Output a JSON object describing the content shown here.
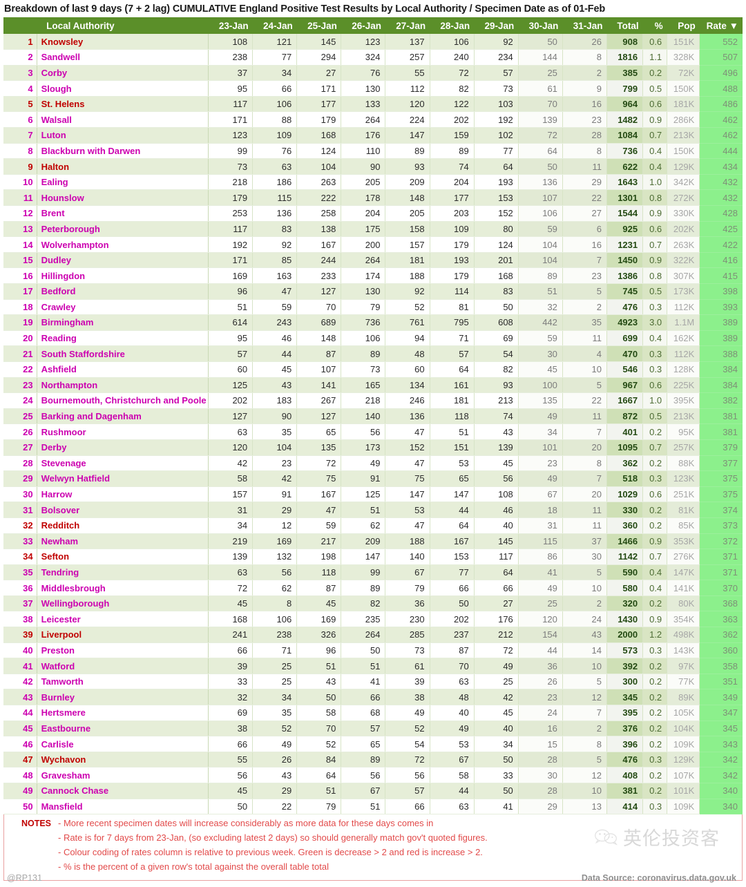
{
  "title": "Breakdown of last 9 days (7 + 2 lag)  CUMULATIVE England Positive Test Results by Local Authority / Specimen Date as of 01-Feb",
  "columns": {
    "rank": "",
    "name": "Local Authority",
    "days": [
      "23-Jan",
      "24-Jan",
      "25-Jan",
      "26-Jan",
      "27-Jan",
      "28-Jan",
      "29-Jan",
      "30-Jan",
      "31-Jan"
    ],
    "total": "Total",
    "pct": "%",
    "pop": "Pop",
    "rate": "Rate ▼"
  },
  "notes": {
    "label": "NOTES",
    "lines": [
      "- More recent specimen dates will increase considerably as more data for these days comes in",
      "- Rate is for 7 days from 23-Jan, (so excluding latest 2 days) so should generally match gov't quoted figures.",
      "- Colour coding of rates column is relative to previous week. Green is decrease > 2 and red is increase > 2.",
      "- % is the percent of a given row's total against the overall table total"
    ]
  },
  "watermark": "英伦投资客",
  "footer": {
    "handle": "@RP131",
    "source": "Data Source: coronavirus.data.gov.uk"
  },
  "colors": {
    "header_green": "#5b8f29",
    "rate_green": "#8cf08c",
    "name_magenta": "#cc00b0",
    "name_red": "#c00000",
    "notes_red": "#e24a4a"
  },
  "chart_data": {
    "type": "table",
    "title": "Breakdown of last 9 days (7 + 2 lag)  CUMULATIVE England Positive Test Results by Local Authority / Specimen Date as of 01-Feb",
    "columns": [
      "Rank",
      "Local Authority",
      "23-Jan",
      "24-Jan",
      "25-Jan",
      "26-Jan",
      "27-Jan",
      "28-Jan",
      "29-Jan",
      "30-Jan",
      "31-Jan",
      "Total",
      "%",
      "Pop",
      "Rate"
    ],
    "lag_columns": [
      "30-Jan",
      "31-Jan"
    ],
    "sorted_by": "Rate",
    "sort_direction": "descending",
    "rows": [
      {
        "rank": 1,
        "name": "Knowsley",
        "flag": "red",
        "v": [
          108,
          121,
          145,
          123,
          137,
          106,
          92,
          50,
          26
        ],
        "total": "908",
        "pct": "0.6",
        "pop": "151K",
        "rate": "552"
      },
      {
        "rank": 2,
        "name": "Sandwell",
        "flag": "mag",
        "v": [
          238,
          77,
          294,
          324,
          257,
          240,
          234,
          144,
          8
        ],
        "total": "1816",
        "pct": "1.1",
        "pop": "328K",
        "rate": "507"
      },
      {
        "rank": 3,
        "name": "Corby",
        "flag": "mag",
        "v": [
          37,
          34,
          27,
          76,
          55,
          72,
          57,
          25,
          2
        ],
        "total": "385",
        "pct": "0.2",
        "pop": "72K",
        "rate": "496"
      },
      {
        "rank": 4,
        "name": "Slough",
        "flag": "mag",
        "v": [
          95,
          66,
          171,
          130,
          112,
          82,
          73,
          61,
          9
        ],
        "total": "799",
        "pct": "0.5",
        "pop": "150K",
        "rate": "488"
      },
      {
        "rank": 5,
        "name": "St. Helens",
        "flag": "red",
        "v": [
          117,
          106,
          177,
          133,
          120,
          122,
          103,
          70,
          16
        ],
        "total": "964",
        "pct": "0.6",
        "pop": "181K",
        "rate": "486"
      },
      {
        "rank": 6,
        "name": "Walsall",
        "flag": "mag",
        "v": [
          171,
          88,
          179,
          264,
          224,
          202,
          192,
          139,
          23
        ],
        "total": "1482",
        "pct": "0.9",
        "pop": "286K",
        "rate": "462"
      },
      {
        "rank": 7,
        "name": "Luton",
        "flag": "mag",
        "v": [
          123,
          109,
          168,
          176,
          147,
          159,
          102,
          72,
          28
        ],
        "total": "1084",
        "pct": "0.7",
        "pop": "213K",
        "rate": "462"
      },
      {
        "rank": 8,
        "name": "Blackburn with Darwen",
        "flag": "mag",
        "v": [
          99,
          76,
          124,
          110,
          89,
          89,
          77,
          64,
          8
        ],
        "total": "736",
        "pct": "0.4",
        "pop": "150K",
        "rate": "444"
      },
      {
        "rank": 9,
        "name": "Halton",
        "flag": "red",
        "v": [
          73,
          63,
          104,
          90,
          93,
          74,
          64,
          50,
          11
        ],
        "total": "622",
        "pct": "0.4",
        "pop": "129K",
        "rate": "434"
      },
      {
        "rank": 10,
        "name": "Ealing",
        "flag": "mag",
        "v": [
          218,
          186,
          263,
          205,
          209,
          204,
          193,
          136,
          29
        ],
        "total": "1643",
        "pct": "1.0",
        "pop": "342K",
        "rate": "432"
      },
      {
        "rank": 11,
        "name": "Hounslow",
        "flag": "mag",
        "v": [
          179,
          115,
          222,
          178,
          148,
          177,
          153,
          107,
          22
        ],
        "total": "1301",
        "pct": "0.8",
        "pop": "272K",
        "rate": "432"
      },
      {
        "rank": 12,
        "name": "Brent",
        "flag": "mag",
        "v": [
          253,
          136,
          258,
          204,
          205,
          203,
          152,
          106,
          27
        ],
        "total": "1544",
        "pct": "0.9",
        "pop": "330K",
        "rate": "428"
      },
      {
        "rank": 13,
        "name": "Peterborough",
        "flag": "mag",
        "v": [
          117,
          83,
          138,
          175,
          158,
          109,
          80,
          59,
          6
        ],
        "total": "925",
        "pct": "0.6",
        "pop": "202K",
        "rate": "425"
      },
      {
        "rank": 14,
        "name": "Wolverhampton",
        "flag": "mag",
        "v": [
          192,
          92,
          167,
          200,
          157,
          179,
          124,
          104,
          16
        ],
        "total": "1231",
        "pct": "0.7",
        "pop": "263K",
        "rate": "422"
      },
      {
        "rank": 15,
        "name": "Dudley",
        "flag": "mag",
        "v": [
          171,
          85,
          244,
          264,
          181,
          193,
          201,
          104,
          7
        ],
        "total": "1450",
        "pct": "0.9",
        "pop": "322K",
        "rate": "416"
      },
      {
        "rank": 16,
        "name": "Hillingdon",
        "flag": "mag",
        "v": [
          169,
          163,
          233,
          174,
          188,
          179,
          168,
          89,
          23
        ],
        "total": "1386",
        "pct": "0.8",
        "pop": "307K",
        "rate": "415"
      },
      {
        "rank": 17,
        "name": "Bedford",
        "flag": "mag",
        "v": [
          96,
          47,
          127,
          130,
          92,
          114,
          83,
          51,
          5
        ],
        "total": "745",
        "pct": "0.5",
        "pop": "173K",
        "rate": "398"
      },
      {
        "rank": 18,
        "name": "Crawley",
        "flag": "mag",
        "v": [
          51,
          59,
          70,
          79,
          52,
          81,
          50,
          32,
          2
        ],
        "total": "476",
        "pct": "0.3",
        "pop": "112K",
        "rate": "393"
      },
      {
        "rank": 19,
        "name": "Birmingham",
        "flag": "mag",
        "v": [
          614,
          243,
          689,
          736,
          761,
          795,
          608,
          442,
          35
        ],
        "total": "4923",
        "pct": "3.0",
        "pop": "1.1M",
        "rate": "389"
      },
      {
        "rank": 20,
        "name": "Reading",
        "flag": "mag",
        "v": [
          95,
          46,
          148,
          106,
          94,
          71,
          69,
          59,
          11
        ],
        "total": "699",
        "pct": "0.4",
        "pop": "162K",
        "rate": "389"
      },
      {
        "rank": 21,
        "name": "South Staffordshire",
        "flag": "mag",
        "v": [
          57,
          44,
          87,
          89,
          48,
          57,
          54,
          30,
          4
        ],
        "total": "470",
        "pct": "0.3",
        "pop": "112K",
        "rate": "388"
      },
      {
        "rank": 22,
        "name": "Ashfield",
        "flag": "mag",
        "v": [
          60,
          45,
          107,
          73,
          60,
          64,
          82,
          45,
          10
        ],
        "total": "546",
        "pct": "0.3",
        "pop": "128K",
        "rate": "384"
      },
      {
        "rank": 23,
        "name": "Northampton",
        "flag": "mag",
        "v": [
          125,
          43,
          141,
          165,
          134,
          161,
          93,
          100,
          5
        ],
        "total": "967",
        "pct": "0.6",
        "pop": "225K",
        "rate": "384"
      },
      {
        "rank": 24,
        "name": "Bournemouth, Christchurch and Poole",
        "flag": "mag",
        "v": [
          202,
          183,
          267,
          218,
          246,
          181,
          213,
          135,
          22
        ],
        "total": "1667",
        "pct": "1.0",
        "pop": "395K",
        "rate": "382"
      },
      {
        "rank": 25,
        "name": "Barking and Dagenham",
        "flag": "mag",
        "v": [
          127,
          90,
          127,
          140,
          136,
          118,
          74,
          49,
          11
        ],
        "total": "872",
        "pct": "0.5",
        "pop": "213K",
        "rate": "381"
      },
      {
        "rank": 26,
        "name": "Rushmoor",
        "flag": "mag",
        "v": [
          63,
          35,
          65,
          56,
          47,
          51,
          43,
          34,
          7
        ],
        "total": "401",
        "pct": "0.2",
        "pop": "95K",
        "rate": "381"
      },
      {
        "rank": 27,
        "name": "Derby",
        "flag": "mag",
        "v": [
          120,
          104,
          135,
          173,
          152,
          151,
          139,
          101,
          20
        ],
        "total": "1095",
        "pct": "0.7",
        "pop": "257K",
        "rate": "379"
      },
      {
        "rank": 28,
        "name": "Stevenage",
        "flag": "mag",
        "v": [
          42,
          23,
          72,
          49,
          47,
          53,
          45,
          23,
          8
        ],
        "total": "362",
        "pct": "0.2",
        "pop": "88K",
        "rate": "377"
      },
      {
        "rank": 29,
        "name": "Welwyn Hatfield",
        "flag": "mag",
        "v": [
          58,
          42,
          75,
          91,
          75,
          65,
          56,
          49,
          7
        ],
        "total": "518",
        "pct": "0.3",
        "pop": "123K",
        "rate": "375"
      },
      {
        "rank": 30,
        "name": "Harrow",
        "flag": "mag",
        "v": [
          157,
          91,
          167,
          125,
          147,
          147,
          108,
          67,
          20
        ],
        "total": "1029",
        "pct": "0.6",
        "pop": "251K",
        "rate": "375"
      },
      {
        "rank": 31,
        "name": "Bolsover",
        "flag": "mag",
        "v": [
          31,
          29,
          47,
          51,
          53,
          44,
          46,
          18,
          11
        ],
        "total": "330",
        "pct": "0.2",
        "pop": "81K",
        "rate": "374"
      },
      {
        "rank": 32,
        "name": "Redditch",
        "flag": "red",
        "v": [
          34,
          12,
          59,
          62,
          47,
          64,
          40,
          31,
          11
        ],
        "total": "360",
        "pct": "0.2",
        "pop": "85K",
        "rate": "373"
      },
      {
        "rank": 33,
        "name": "Newham",
        "flag": "mag",
        "v": [
          219,
          169,
          217,
          209,
          188,
          167,
          145,
          115,
          37
        ],
        "total": "1466",
        "pct": "0.9",
        "pop": "353K",
        "rate": "372"
      },
      {
        "rank": 34,
        "name": "Sefton",
        "flag": "red",
        "v": [
          139,
          132,
          198,
          147,
          140,
          153,
          117,
          86,
          30
        ],
        "total": "1142",
        "pct": "0.7",
        "pop": "276K",
        "rate": "371"
      },
      {
        "rank": 35,
        "name": "Tendring",
        "flag": "mag",
        "v": [
          63,
          56,
          118,
          99,
          67,
          77,
          64,
          41,
          5
        ],
        "total": "590",
        "pct": "0.4",
        "pop": "147K",
        "rate": "371"
      },
      {
        "rank": 36,
        "name": "Middlesbrough",
        "flag": "mag",
        "v": [
          72,
          62,
          87,
          89,
          79,
          66,
          66,
          49,
          10
        ],
        "total": "580",
        "pct": "0.4",
        "pop": "141K",
        "rate": "370"
      },
      {
        "rank": 37,
        "name": "Wellingborough",
        "flag": "mag",
        "v": [
          45,
          8,
          45,
          82,
          36,
          50,
          27,
          25,
          2
        ],
        "total": "320",
        "pct": "0.2",
        "pop": "80K",
        "rate": "368"
      },
      {
        "rank": 38,
        "name": "Leicester",
        "flag": "mag",
        "v": [
          168,
          106,
          169,
          235,
          230,
          202,
          176,
          120,
          24
        ],
        "total": "1430",
        "pct": "0.9",
        "pop": "354K",
        "rate": "363"
      },
      {
        "rank": 39,
        "name": "Liverpool",
        "flag": "red",
        "v": [
          241,
          238,
          326,
          264,
          285,
          237,
          212,
          154,
          43
        ],
        "total": "2000",
        "pct": "1.2",
        "pop": "498K",
        "rate": "362"
      },
      {
        "rank": 40,
        "name": "Preston",
        "flag": "mag",
        "v": [
          66,
          71,
          96,
          50,
          73,
          87,
          72,
          44,
          14
        ],
        "total": "573",
        "pct": "0.3",
        "pop": "143K",
        "rate": "360"
      },
      {
        "rank": 41,
        "name": "Watford",
        "flag": "mag",
        "v": [
          39,
          25,
          51,
          51,
          61,
          70,
          49,
          36,
          10
        ],
        "total": "392",
        "pct": "0.2",
        "pop": "97K",
        "rate": "358"
      },
      {
        "rank": 42,
        "name": "Tamworth",
        "flag": "mag",
        "v": [
          33,
          25,
          43,
          41,
          39,
          63,
          25,
          26,
          5
        ],
        "total": "300",
        "pct": "0.2",
        "pop": "77K",
        "rate": "351"
      },
      {
        "rank": 43,
        "name": "Burnley",
        "flag": "mag",
        "v": [
          32,
          34,
          50,
          66,
          38,
          48,
          42,
          23,
          12
        ],
        "total": "345",
        "pct": "0.2",
        "pop": "89K",
        "rate": "349"
      },
      {
        "rank": 44,
        "name": "Hertsmere",
        "flag": "mag",
        "v": [
          69,
          35,
          58,
          68,
          49,
          40,
          45,
          24,
          7
        ],
        "total": "395",
        "pct": "0.2",
        "pop": "105K",
        "rate": "347"
      },
      {
        "rank": 45,
        "name": "Eastbourne",
        "flag": "mag",
        "v": [
          38,
          52,
          70,
          57,
          52,
          49,
          40,
          16,
          2
        ],
        "total": "376",
        "pct": "0.2",
        "pop": "104K",
        "rate": "345"
      },
      {
        "rank": 46,
        "name": "Carlisle",
        "flag": "mag",
        "v": [
          66,
          49,
          52,
          65,
          54,
          53,
          34,
          15,
          8
        ],
        "total": "396",
        "pct": "0.2",
        "pop": "109K",
        "rate": "343"
      },
      {
        "rank": 47,
        "name": "Wychavon",
        "flag": "red",
        "v": [
          55,
          26,
          84,
          89,
          72,
          67,
          50,
          28,
          5
        ],
        "total": "476",
        "pct": "0.3",
        "pop": "129K",
        "rate": "342"
      },
      {
        "rank": 48,
        "name": "Gravesham",
        "flag": "mag",
        "v": [
          56,
          43,
          64,
          56,
          56,
          58,
          33,
          30,
          12
        ],
        "total": "408",
        "pct": "0.2",
        "pop": "107K",
        "rate": "342"
      },
      {
        "rank": 49,
        "name": "Cannock Chase",
        "flag": "mag",
        "v": [
          45,
          29,
          51,
          67,
          57,
          44,
          50,
          28,
          10
        ],
        "total": "381",
        "pct": "0.2",
        "pop": "101K",
        "rate": "340"
      },
      {
        "rank": 50,
        "name": "Mansfield",
        "flag": "mag",
        "v": [
          50,
          22,
          79,
          51,
          66,
          63,
          41,
          29,
          13
        ],
        "total": "414",
        "pct": "0.3",
        "pop": "109K",
        "rate": "340"
      }
    ]
  }
}
